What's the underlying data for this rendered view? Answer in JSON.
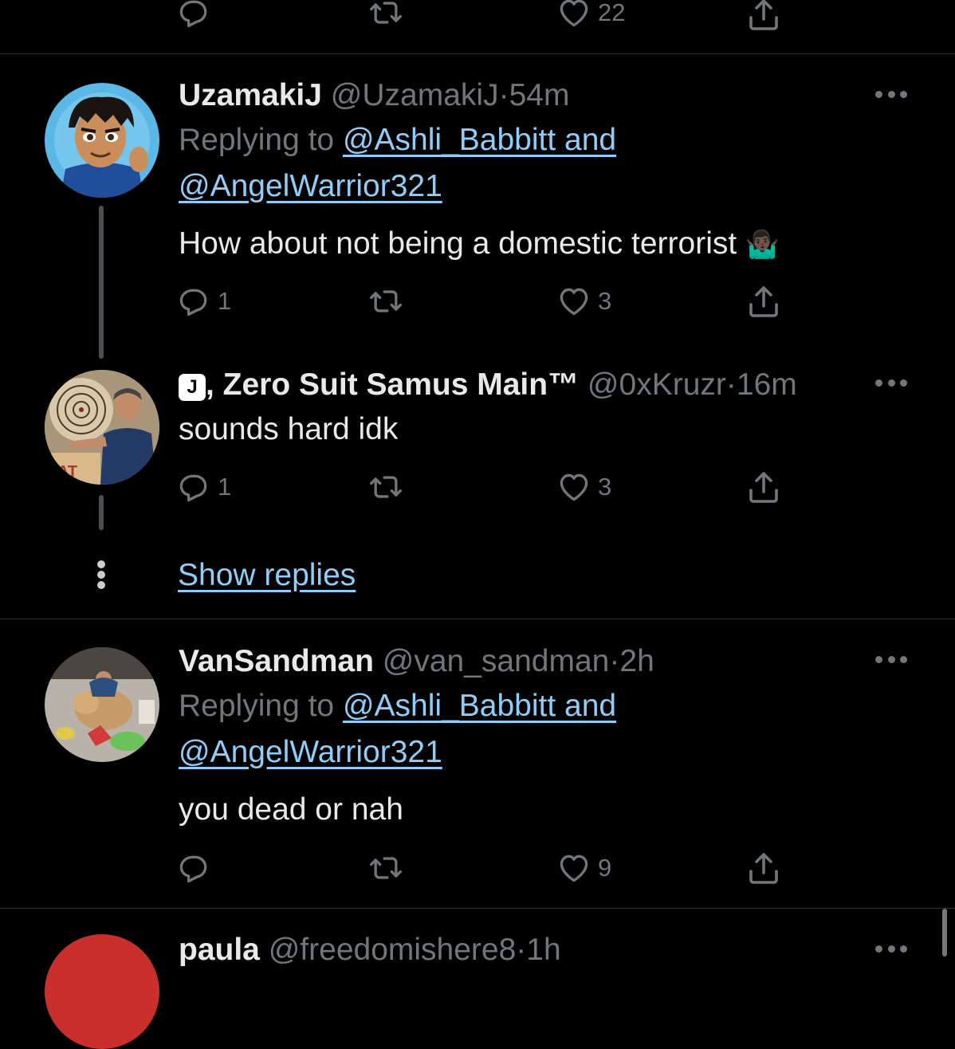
{
  "top_actions": {
    "like_count": "22"
  },
  "tweets": [
    {
      "display_name": "UzamakiJ",
      "handle": "@UzamakiJ",
      "separator": "·",
      "time": "54m",
      "replying_prefix": "Replying to ",
      "replying_link_line1": "@Ashli_Babbitt and",
      "replying_link_line2": "@AngelWarrior321",
      "text": "How about not being a domestic terrorist",
      "emoji": "🤷🏿‍♂️",
      "reply_count": "1",
      "like_count": "3"
    },
    {
      "badge": "J",
      "display_name": ", Zero Suit Samus Main™",
      "handle": "@0xKruzr",
      "separator": "·",
      "time": "16m",
      "text": "sounds hard idk",
      "reply_count": "1",
      "like_count": "3"
    },
    {
      "display_name": "VanSandman",
      "handle": "@van_sandman",
      "separator": "·",
      "time": "2h",
      "replying_prefix": "Replying to ",
      "replying_link_line1": "@Ashli_Babbitt and",
      "replying_link_line2": "@AngelWarrior321",
      "text": "you dead or nah",
      "like_count": "9"
    },
    {
      "display_name": "paula",
      "handle": "@freedomishere8",
      "separator": "·",
      "time": "1h"
    }
  ],
  "show_replies_label": "Show replies",
  "colors": {
    "background": "#000000",
    "text": "#e7e9ea",
    "secondary": "#71767b",
    "link": "#8ecdf8",
    "divider": "#2f3336"
  },
  "icons": [
    "reply-icon",
    "retweet-icon",
    "like-icon",
    "share-icon",
    "more-icon"
  ]
}
